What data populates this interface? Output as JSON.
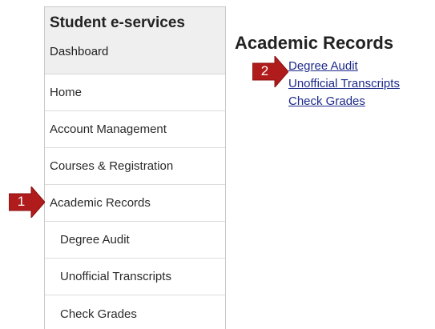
{
  "sidebar": {
    "title": "Student e-services",
    "subtitle": "Dashboard",
    "items": [
      {
        "label": "Home"
      },
      {
        "label": "Account Management"
      },
      {
        "label": "Courses & Registration"
      },
      {
        "label": "Academic Records"
      },
      {
        "label": "Degree Audit"
      },
      {
        "label": "Unofficial Transcripts"
      },
      {
        "label": "Check Grades"
      }
    ]
  },
  "main": {
    "title": "Academic Records",
    "links": [
      {
        "label": "Degree Audit"
      },
      {
        "label": "Unofficial Transcripts"
      },
      {
        "label": "Check Grades"
      }
    ]
  },
  "callouts": [
    {
      "number": "1",
      "icon": "arrow-right-icon"
    },
    {
      "number": "2",
      "icon": "arrow-right-icon"
    }
  ],
  "colors": {
    "callout": "#b01c1c",
    "link": "#1c2a8a",
    "header_bg": "#efefef"
  }
}
